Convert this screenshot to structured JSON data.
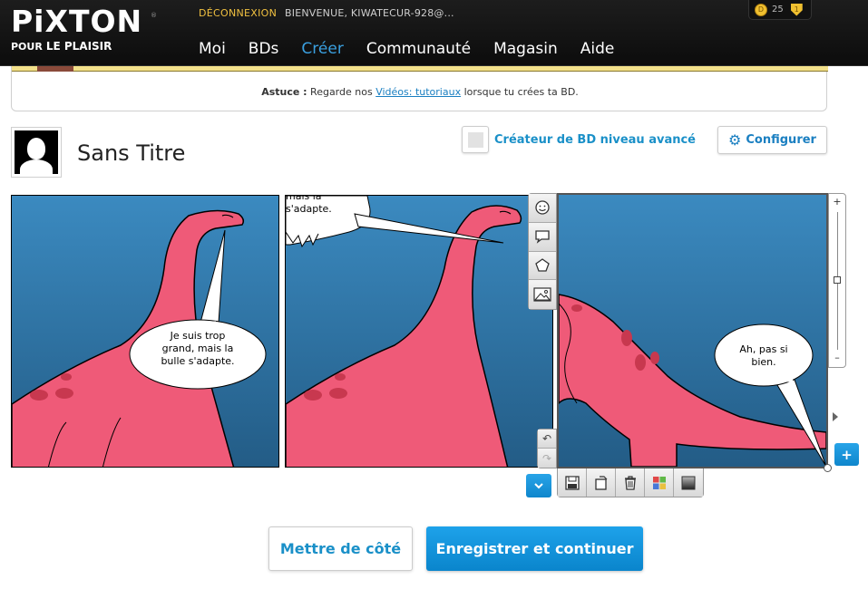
{
  "header": {
    "logo_text": "PiXTON",
    "logo_trademark": "®",
    "logo_sub_small": "POUR",
    "logo_sub_big": "LE PLAISIR",
    "logout_label": "DÉCONNEXION",
    "welcome_text": "BIENVENUE, KIWATECUR-928@...",
    "nav": [
      {
        "label": "Moi"
      },
      {
        "label": "BDs"
      },
      {
        "label": "Créer"
      },
      {
        "label": "Communauté"
      },
      {
        "label": "Magasin"
      },
      {
        "label": "Aide"
      }
    ],
    "active_nav": "Créer",
    "coins": "25",
    "coin_symbol": "D",
    "badge_symbol": "1"
  },
  "tip": {
    "prefix": "Astuce :",
    "text_before": " Regarde nos ",
    "link": "Vidéos: tutoriaux",
    "text_after": " lorsque tu crées ta BD."
  },
  "comic": {
    "title": "Sans Titre",
    "advanced_label": "Créateur de BD niveau avancé",
    "configure_label": "Configurer",
    "panels": [
      {
        "bubble_lines": [
          "Je suis trop",
          "grand, mais la",
          "bulle s'adapte."
        ]
      },
      {
        "bubble_lines": [
          "mais la",
          "s'adapte."
        ]
      },
      {
        "bubble_lines": [
          "Ah, pas si",
          "bien."
        ]
      }
    ]
  },
  "zoom": {
    "plus": "+",
    "minus": "–"
  },
  "undo": {
    "undo": "↶",
    "redo": "↷"
  },
  "add_panel": "+",
  "actions": {
    "aside_label": "Mettre de côté",
    "save_label": "Enregistrer et continuer"
  },
  "colors": {
    "accent": "#1a90c8",
    "nav_active": "#3aa0e0",
    "dino": "#ef5a78",
    "sky_top": "#3b8ac0",
    "sky_bottom": "#235c86"
  }
}
